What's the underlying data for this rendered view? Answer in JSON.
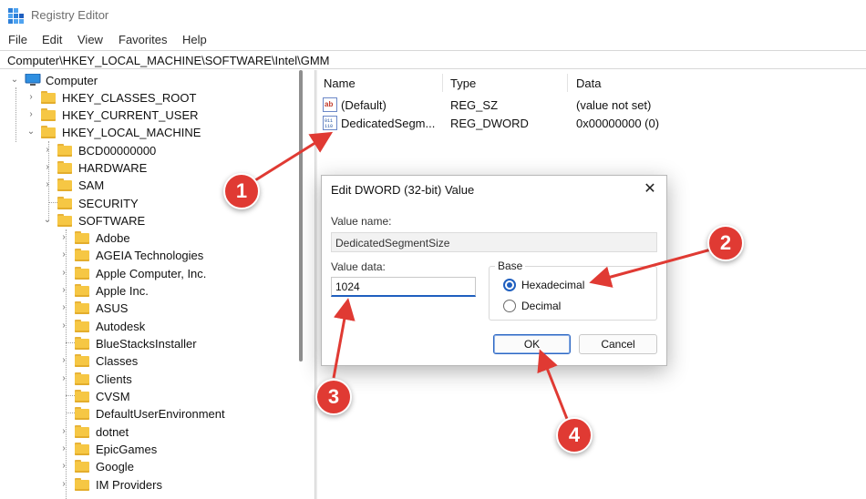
{
  "window": {
    "title": "Registry Editor",
    "icon": "registry-editor-icon"
  },
  "menu": [
    "File",
    "Edit",
    "View",
    "Favorites",
    "Help"
  ],
  "address": "Computer\\HKEY_LOCAL_MACHINE\\SOFTWARE\\Intel\\GMM",
  "tree": {
    "root": "Computer",
    "hives": [
      "HKEY_CLASSES_ROOT",
      "HKEY_CURRENT_USER",
      "HKEY_LOCAL_MACHINE"
    ],
    "hklm_children": [
      "BCD00000000",
      "HARDWARE",
      "SAM",
      "SECURITY",
      "SOFTWARE"
    ],
    "software_children": [
      "Adobe",
      "AGEIA Technologies",
      "Apple Computer, Inc.",
      "Apple Inc.",
      "ASUS",
      "Autodesk",
      "BlueStacksInstaller",
      "Classes",
      "Clients",
      "CVSM",
      "DefaultUserEnvironment",
      "dotnet",
      "EpicGames",
      "Google",
      "IM Providers"
    ]
  },
  "list": {
    "columns": [
      "Name",
      "Type",
      "Data"
    ],
    "rows": [
      {
        "name": "(Default)",
        "type": "REG_SZ",
        "data": "(value not set)",
        "icon": "string-value-icon"
      },
      {
        "name": "DedicatedSegm...",
        "type": "REG_DWORD",
        "data": "0x00000000 (0)",
        "icon": "binary-value-icon"
      }
    ]
  },
  "dialog": {
    "title": "Edit DWORD (32-bit) Value",
    "value_name_label": "Value name:",
    "value_name": "DedicatedSegmentSize",
    "value_data_label": "Value data:",
    "value_data": "1024",
    "base_label": "Base",
    "base_options": [
      "Hexadecimal",
      "Decimal"
    ],
    "base_selected": "Hexadecimal",
    "ok": "OK",
    "cancel": "Cancel",
    "close": "✕"
  },
  "annotations": {
    "color": "#e03a33",
    "steps": [
      "1",
      "2",
      "3",
      "4"
    ]
  }
}
